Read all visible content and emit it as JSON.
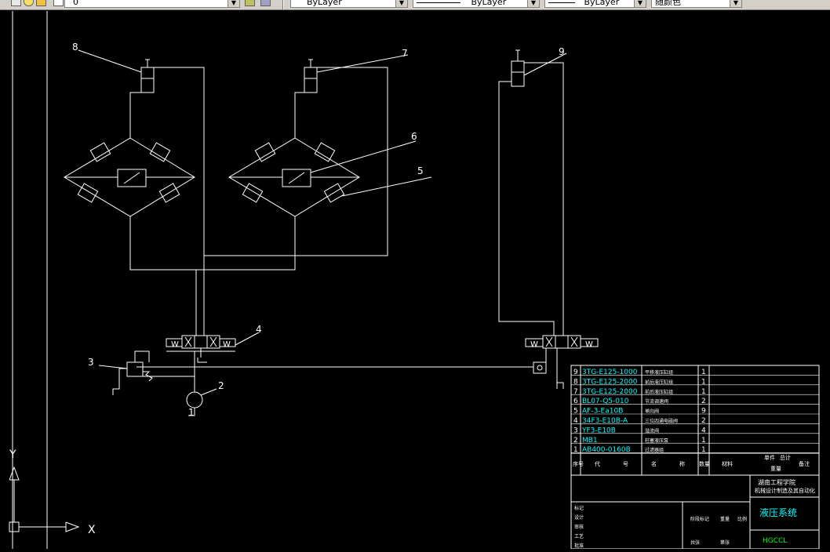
{
  "toolbar": {
    "layer_name": "0",
    "color_value": "ByLayer",
    "linetype_value": "ByLayer",
    "lineweight_value": "ByLayer",
    "plotstyle_value": "随颜色"
  },
  "drawing": {
    "callouts": [
      "1",
      "2",
      "3",
      "4",
      "5",
      "6",
      "7",
      "8",
      "9"
    ],
    "ucs": {
      "y_label": "Y",
      "x_label": "X"
    },
    "valve_w": "W"
  },
  "parts_list": {
    "rows": [
      {
        "no": "9",
        "code": "3TG-E125-1000",
        "name": "平移液压缸组",
        "qty": "1"
      },
      {
        "no": "8",
        "code": "3TG-E125-2000",
        "name": "前后液压缸组",
        "qty": "1"
      },
      {
        "no": "7",
        "code": "3TG-E125-2000",
        "name": "前后液压缸组",
        "qty": "1"
      },
      {
        "no": "6",
        "code": "BL07-Q5-010",
        "name": "节流调速阀",
        "qty": "2"
      },
      {
        "no": "5",
        "code": "AF-3-Ea10B",
        "name": "单向阀",
        "qty": "9"
      },
      {
        "no": "4",
        "code": "34F3-E10B-A",
        "name": "三位四通电磁阀",
        "qty": "2"
      },
      {
        "no": "3",
        "code": "YF3-E10B",
        "name": "溢流阀",
        "qty": "4"
      },
      {
        "no": "2",
        "code": "MB1",
        "name": "柱塞液压泵",
        "qty": "1"
      },
      {
        "no": "1",
        "code": "AB400-0160B",
        "name": "过滤器组",
        "qty": "1"
      }
    ],
    "header": [
      "序号",
      "代",
      "号",
      "名",
      "称",
      "数量",
      "材料",
      "单件",
      "总计",
      "备注"
    ],
    "weight_label": "重量"
  },
  "title_block": {
    "school": "湖南工程学院",
    "subtitle": "机械设计制造及其自动化",
    "drawing_title": "液压系统",
    "code": "HGCCL",
    "labels": [
      "标记",
      "设计",
      "审核",
      "工艺",
      "批准",
      "阶段标记",
      "重量",
      "比例",
      "共张",
      "第张"
    ]
  }
}
